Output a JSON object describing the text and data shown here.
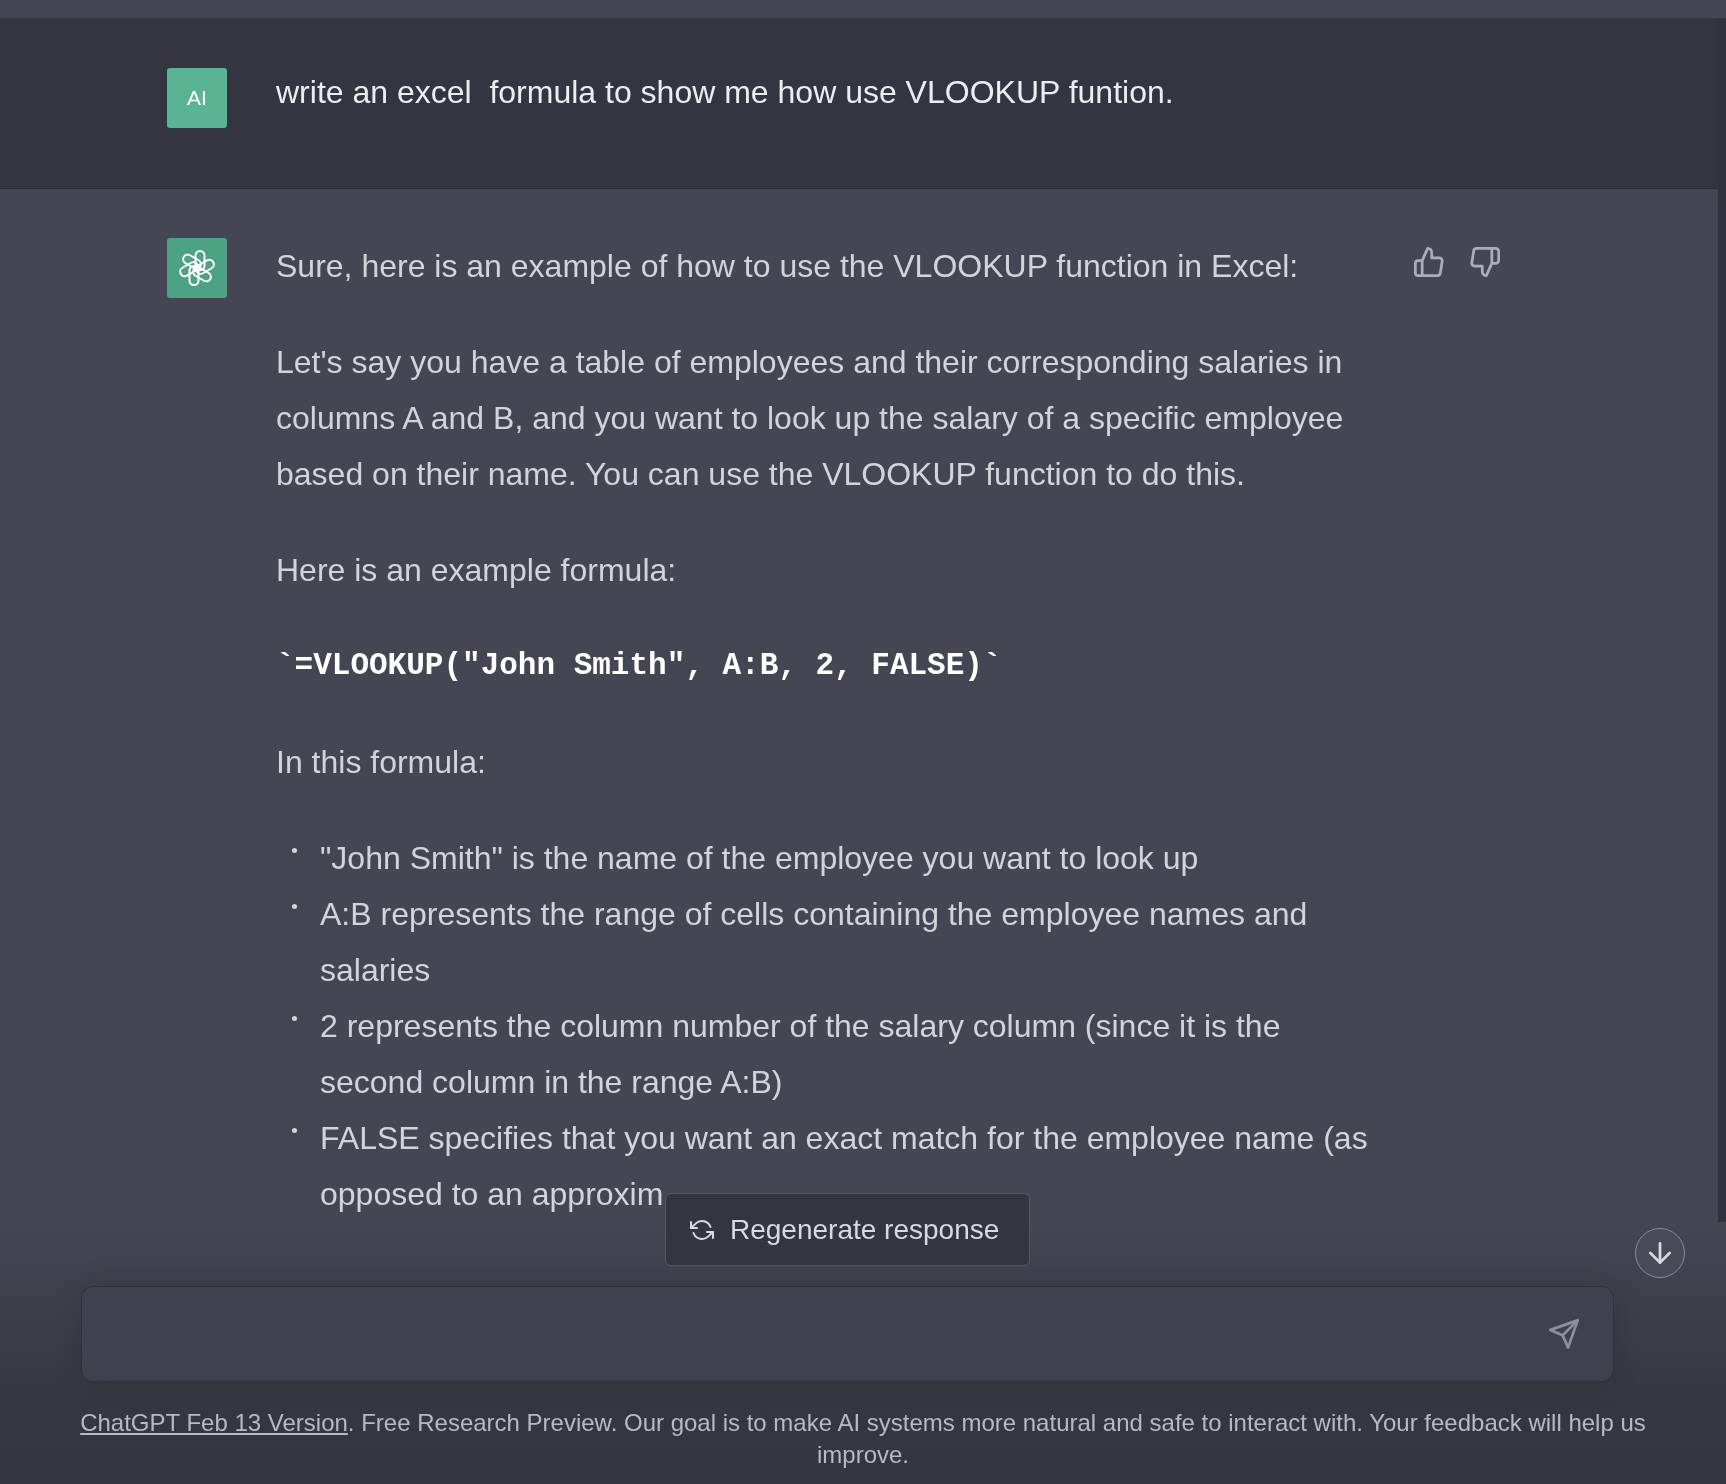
{
  "user_message": {
    "avatar": "AI",
    "text": "write an excel  formula to show me how use VLOOKUP funtion."
  },
  "assistant_message": {
    "blocks": [
      {
        "kind": "paragraph",
        "text": "Sure, here is an example of how to use the VLOOKUP function in Excel:"
      },
      {
        "kind": "paragraph",
        "text": "Let's say you have a table of employees and their corresponding salaries in columns A and B, and you want to look up the salary of a specific employee based on their name. You can use the VLOOKUP function to do this."
      },
      {
        "kind": "paragraph",
        "text": "Here is an example formula:"
      },
      {
        "kind": "code",
        "text": "`=VLOOKUP(\"John Smith\", A:B, 2, FALSE)`"
      },
      {
        "kind": "paragraph",
        "text": "In this formula:"
      },
      {
        "kind": "list",
        "items": [
          "\"John Smith\" is the name of the employee you want to look up",
          "A:B represents the range of cells containing the employee names and salaries",
          "2 represents the column number of the salary column (since it is the second column in the range A:B)",
          "FALSE specifies that you want an exact match for the employee name (as opposed to an approxim"
        ]
      }
    ]
  },
  "regenerate_button": {
    "label": "Regenerate response"
  },
  "footer": {
    "link": "ChatGPT Feb 13 Version",
    "text": ". Free Research Preview. Our goal is to make AI systems more natural and safe to interact with. Your feedback will help us improve."
  }
}
